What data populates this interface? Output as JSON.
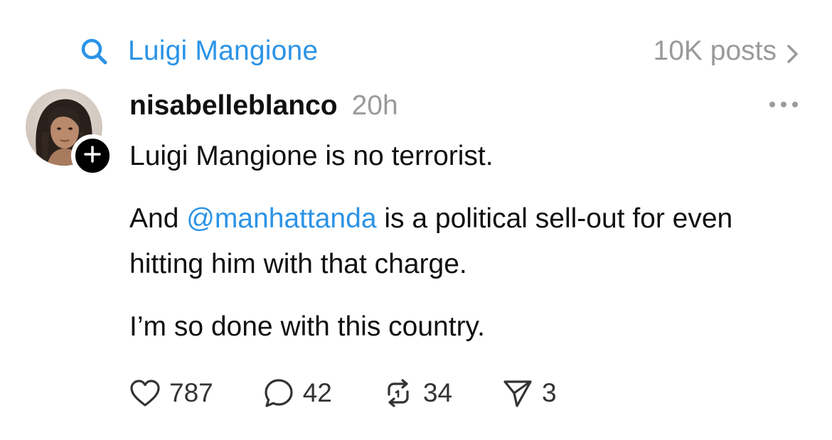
{
  "topic": {
    "name": "Luigi Mangione",
    "posts_count": "10K posts",
    "icon": "search-icon",
    "chevron": "chevron-right-icon",
    "accent_color": "#2b93e6"
  },
  "post": {
    "username": "nisabelleblanco",
    "timestamp": "20h",
    "paragraphs": {
      "p1": "Luigi Mangione is no terrorist.",
      "p2_before": "And ",
      "p2_mention": "@manhattanda",
      "p2_after": " is a political sell-out for even hitting him with that charge.",
      "p3": "I’m so done with this country."
    },
    "actions": {
      "likes": "787",
      "replies": "42",
      "reposts": "34",
      "shares": "3"
    }
  }
}
